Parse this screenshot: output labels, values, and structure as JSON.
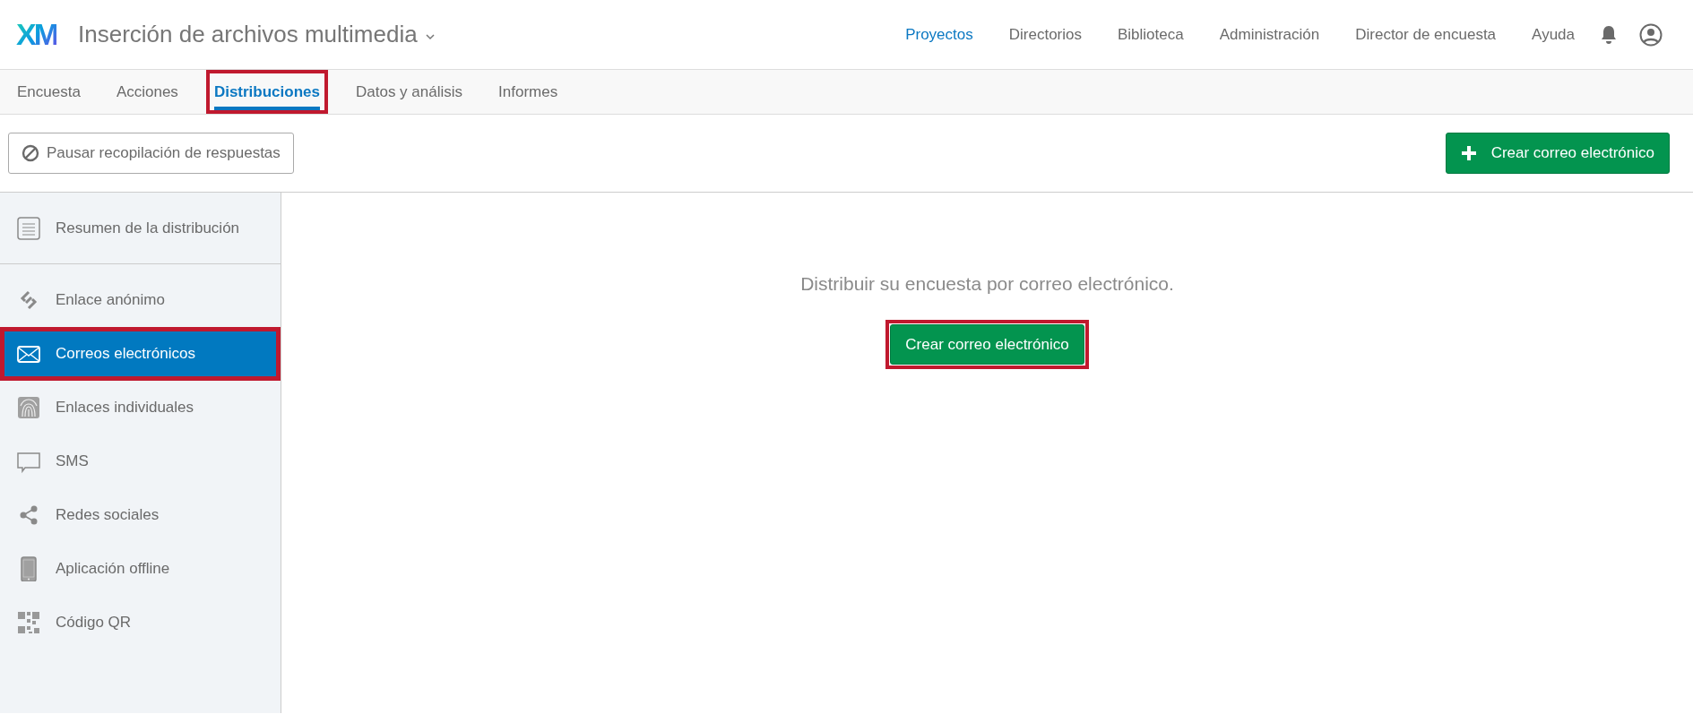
{
  "app": {
    "logo": "XM",
    "project_title": "Inserción de archivos multimedia"
  },
  "top_nav": [
    {
      "label": "Proyectos",
      "selected": true
    },
    {
      "label": "Directorios",
      "selected": false
    },
    {
      "label": "Biblioteca",
      "selected": false
    },
    {
      "label": "Administración",
      "selected": false
    },
    {
      "label": "Director de encuesta",
      "selected": false
    },
    {
      "label": "Ayuda",
      "selected": false
    }
  ],
  "tabs": [
    {
      "label": "Encuesta",
      "selected": false,
      "highlighted": false
    },
    {
      "label": "Acciones",
      "selected": false,
      "highlighted": false
    },
    {
      "label": "Distribuciones",
      "selected": true,
      "highlighted": true
    },
    {
      "label": "Datos y análisis",
      "selected": false,
      "highlighted": false
    },
    {
      "label": "Informes",
      "selected": false,
      "highlighted": false
    }
  ],
  "toolbar": {
    "pause_button": "Pausar recopilación de respuestas",
    "create_button": "Crear correo electrónico"
  },
  "sidebar": {
    "items": [
      {
        "kind": "summary",
        "label": "Resumen de la distribución",
        "selected": false,
        "highlighted": false
      },
      {
        "kind": "link",
        "label": "Enlace anónimo",
        "selected": false,
        "highlighted": false
      },
      {
        "kind": "email",
        "label": "Correos electrónicos",
        "selected": true,
        "highlighted": true
      },
      {
        "kind": "fingerprint",
        "label": "Enlaces individuales",
        "selected": false,
        "highlighted": false
      },
      {
        "kind": "sms",
        "label": "SMS",
        "selected": false,
        "highlighted": false
      },
      {
        "kind": "share",
        "label": "Redes sociales",
        "selected": false,
        "highlighted": false
      },
      {
        "kind": "device",
        "label": "Aplicación offline",
        "selected": false,
        "highlighted": false
      },
      {
        "kind": "qr",
        "label": "Código QR",
        "selected": false,
        "highlighted": false
      }
    ]
  },
  "main": {
    "message": "Distribuir su encuesta por correo electrónico.",
    "button": {
      "label": "Crear correo electrónico",
      "highlighted": true
    }
  }
}
